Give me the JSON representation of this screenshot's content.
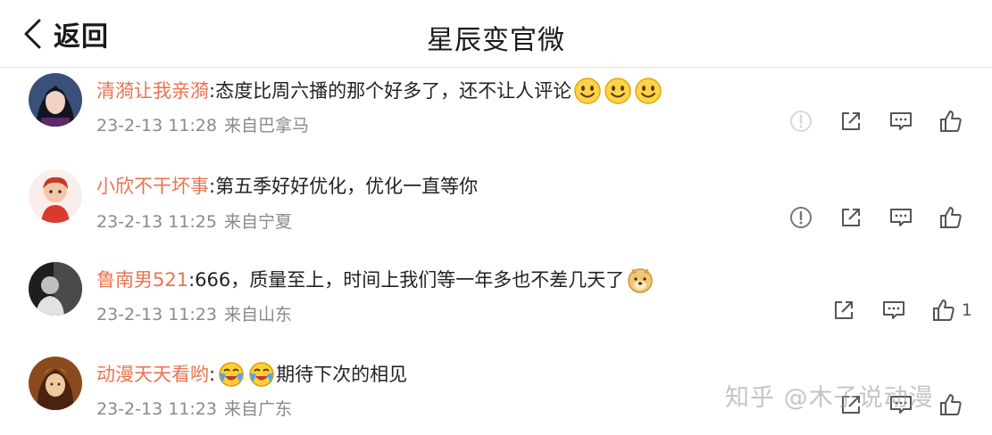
{
  "header": {
    "back_label": "返回",
    "title": "星辰变官微"
  },
  "comments": [
    {
      "user": "清漪让我亲漪",
      "sep": ":",
      "text": "态度比周六播的那个好多了，还不让人评论",
      "emojis_after": [
        "smile-emoji",
        "smile-emoji",
        "smile-emoji"
      ],
      "date": "23-2-13 11:28",
      "source": "来自巴拿马",
      "avatar_colors": [
        "#2b3a6b",
        "#f1d2c4",
        "#1c1c2a"
      ]
    },
    {
      "user": "小欣不干坏事",
      "sep": ":",
      "text": "第五季好好优化，优化一直等你",
      "emojis_after": [],
      "date": "23-2-13 11:25",
      "source": "来自宁夏",
      "avatar_colors": [
        "#fbe9e4",
        "#d83b2d",
        "#f4c7a8"
      ]
    },
    {
      "user": "鲁南男521",
      "sep": ":",
      "text": "666，质量至上，时间上我们等一年多也不差几天了",
      "emojis_after": [
        "doge-emoji"
      ],
      "date": "23-2-13 11:23",
      "source": "来自山东",
      "like_count": "1",
      "avatar_colors": [
        "#2a2a2a",
        "#6b6b6b",
        "#d8d8d8"
      ]
    },
    {
      "user": "动漫天天看哟",
      "sep": ":",
      "emojis_before": [
        "crying-laugh-emoji",
        "crying-laugh-emoji"
      ],
      "text": "期待下次的相见",
      "date": "23-2-13 11:23",
      "source": "来自广东",
      "avatar_colors": [
        "#7a3a1c",
        "#f0c9a0",
        "#c4862a"
      ]
    }
  ],
  "watermark": "知乎 @木子说动漫",
  "colors": {
    "username": "#eb7350",
    "meta": "#8a8a8a",
    "icon": "#555555"
  }
}
